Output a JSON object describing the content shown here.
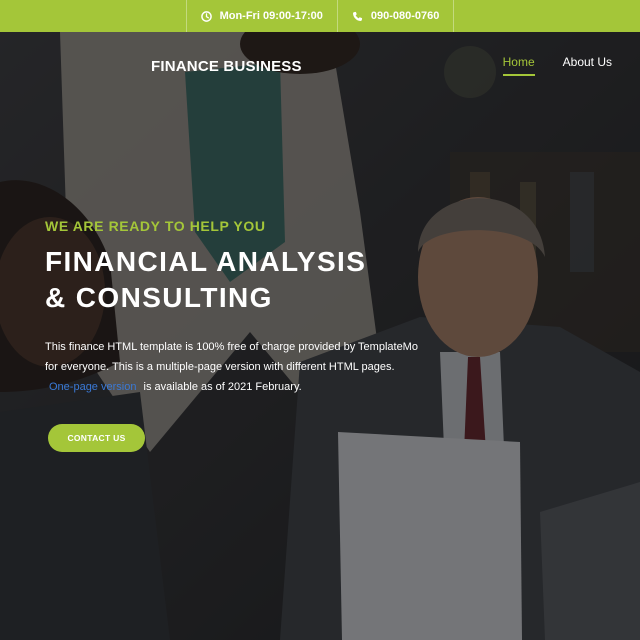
{
  "topbar": {
    "hours": "Mon-Fri 09:00-17:00",
    "phone": "090-080-0760",
    "hours_icon": "clock-icon",
    "phone_icon": "phone-icon"
  },
  "header": {
    "brand": "FINANCE BUSINESS",
    "nav": [
      {
        "label": "Home",
        "active": true
      },
      {
        "label": "About Us",
        "active": false
      }
    ]
  },
  "hero": {
    "eyebrow": "WE ARE READY TO HELP YOU",
    "headline_line1": "FINANCIAL ANALYSIS",
    "headline_line2": "& CONSULTING",
    "desc_part1": "This finance HTML template is 100% free of charge provided by TemplateMo for everyone. This is a multiple-page version with different HTML pages.",
    "desc_link": "One-page version",
    "desc_part2": "is available as of 2021 February.",
    "cta_label": "CONTACT US",
    "background_image": "photo of business people reviewing documents at a desk"
  },
  "colors": {
    "accent": "#a4c639",
    "link": "#3a79d6",
    "overlay": "#141416"
  }
}
